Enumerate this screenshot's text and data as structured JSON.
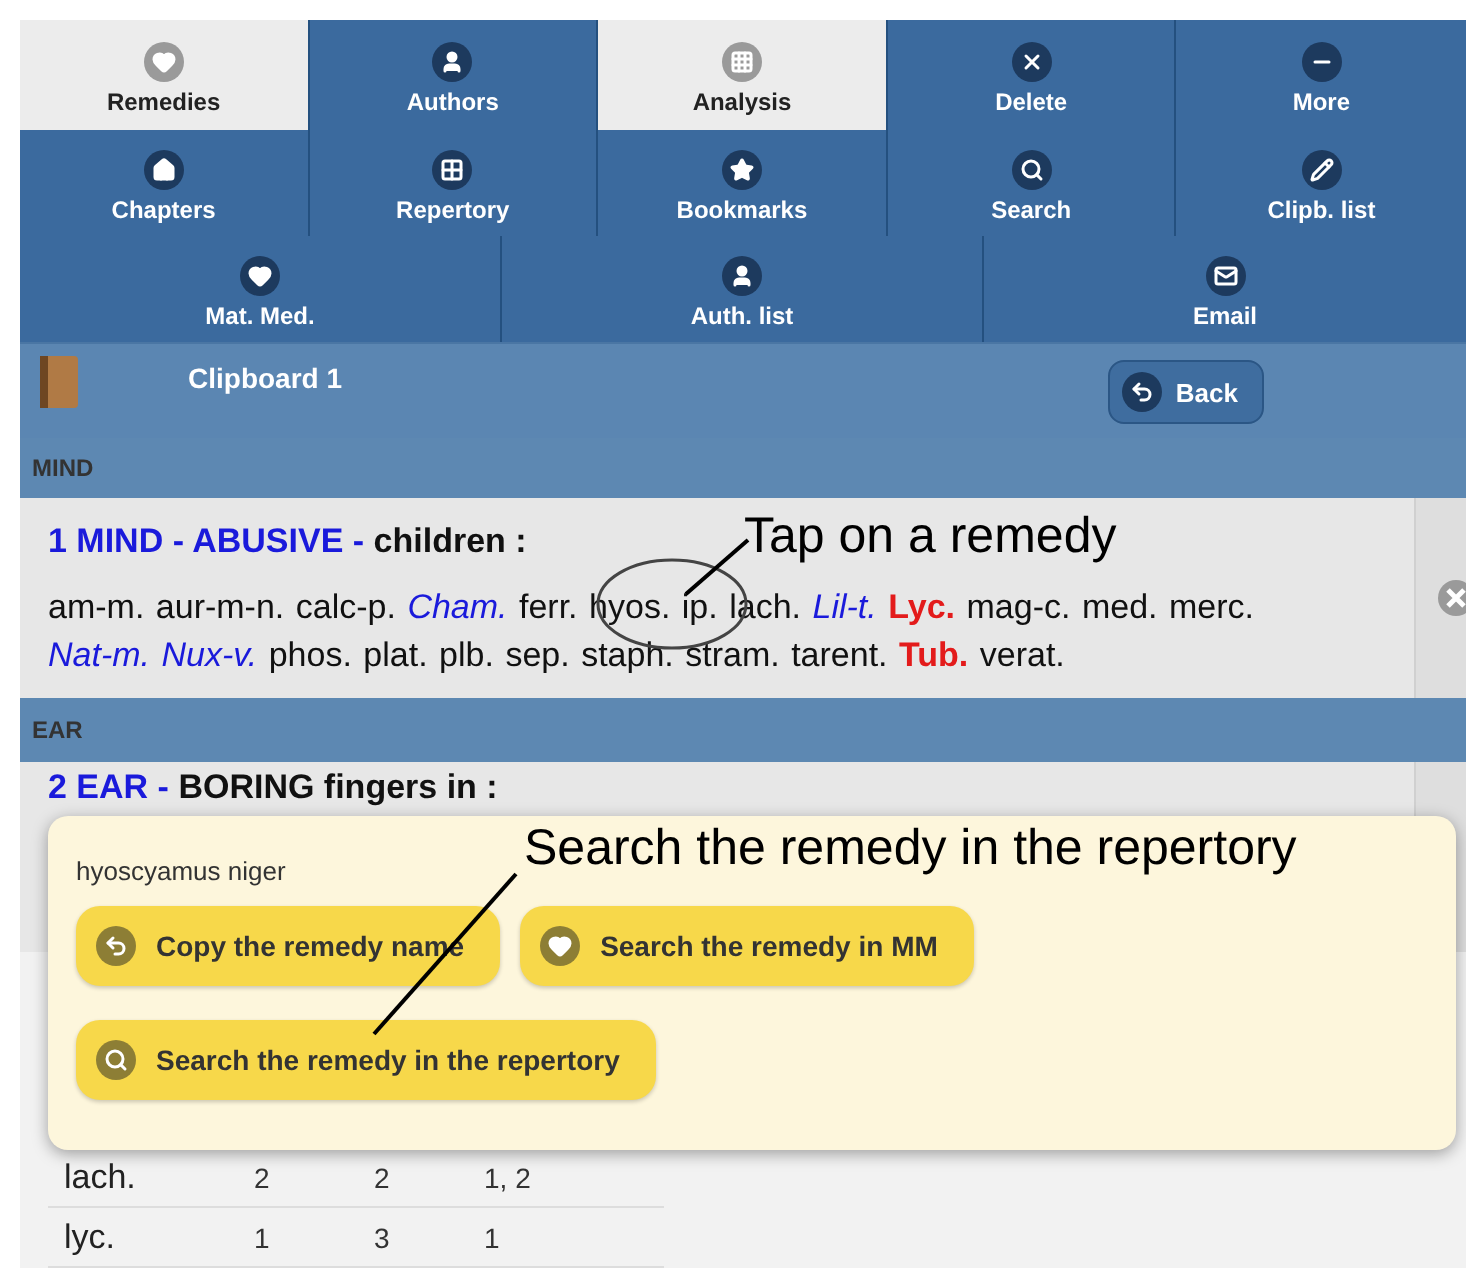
{
  "toolbar": {
    "upper_grid": [
      [
        {
          "label": "Remedies",
          "selected": true
        },
        {
          "label": "Authors",
          "selected": false
        },
        {
          "label": "Analysis",
          "selected": true
        },
        {
          "label": "Delete",
          "selected": false
        },
        {
          "label": "More",
          "selected": false
        }
      ],
      [
        {
          "label": "Chapters",
          "selected": false
        },
        {
          "label": "Repertory",
          "selected": false
        },
        {
          "label": "Bookmarks",
          "selected": false
        },
        {
          "label": "Search",
          "selected": false
        },
        {
          "label": "Clipb. list",
          "selected": false
        }
      ]
    ],
    "lower_row": [
      {
        "label": "Mat. Med.",
        "selected": false
      },
      {
        "label": "Auth. list",
        "selected": false
      },
      {
        "label": "Email",
        "selected": false
      }
    ]
  },
  "clipboard_bar": {
    "title": "Clipboard 1",
    "back_button": "Back"
  },
  "sections": [
    {
      "header": "MIND",
      "entry": {
        "path": "1 MIND - ABUSIVE -",
        "sub": "children :",
        "remedies": [
          {
            "name": "am-m.",
            "kind": "plain"
          },
          {
            "name": "aur-m-n.",
            "kind": "plain"
          },
          {
            "name": "calc-p.",
            "kind": "plain"
          },
          {
            "name": "Cham.",
            "kind": "italic"
          },
          {
            "name": "ferr.",
            "kind": "plain"
          },
          {
            "name": "hyos.",
            "kind": "plain"
          },
          {
            "name": "ip.",
            "kind": "plain"
          },
          {
            "name": "lach.",
            "kind": "plain"
          },
          {
            "name": "Lil-t.",
            "kind": "italic"
          },
          {
            "name": "Lyc.",
            "kind": "bold"
          },
          {
            "name": "mag-c.",
            "kind": "plain"
          },
          {
            "name": "med.",
            "kind": "plain"
          },
          {
            "name": "merc.",
            "kind": "plain"
          },
          {
            "name": "Nat-m.",
            "kind": "italic"
          },
          {
            "name": "Nux-v.",
            "kind": "italic"
          },
          {
            "name": "phos.",
            "kind": "plain"
          },
          {
            "name": "plat.",
            "kind": "plain"
          },
          {
            "name": "plb.",
            "kind": "plain"
          },
          {
            "name": "sep.",
            "kind": "plain"
          },
          {
            "name": "staph.",
            "kind": "plain"
          },
          {
            "name": "stram.",
            "kind": "plain"
          },
          {
            "name": "tarent.",
            "kind": "plain"
          },
          {
            "name": "Tub.",
            "kind": "bold"
          },
          {
            "name": "verat.",
            "kind": "plain"
          }
        ]
      }
    },
    {
      "header": "EAR",
      "entry": {
        "path": "2 EAR -",
        "sub": "BORING fingers in :"
      }
    }
  ],
  "table": {
    "rows": [
      {
        "remedy": "lach.",
        "cells": [
          "2",
          "2",
          "1, 2"
        ]
      },
      {
        "remedy": "lyc.",
        "cells": [
          "1",
          "3",
          "1"
        ]
      }
    ]
  },
  "popup": {
    "title": "hyoscyamus niger",
    "buttons": [
      "Copy the remedy name",
      "Search the remedy in MM",
      "Search the remedy in the repertory"
    ]
  },
  "annotations": [
    "Tap on a remedy",
    "Search the remedy in the repertory"
  ]
}
